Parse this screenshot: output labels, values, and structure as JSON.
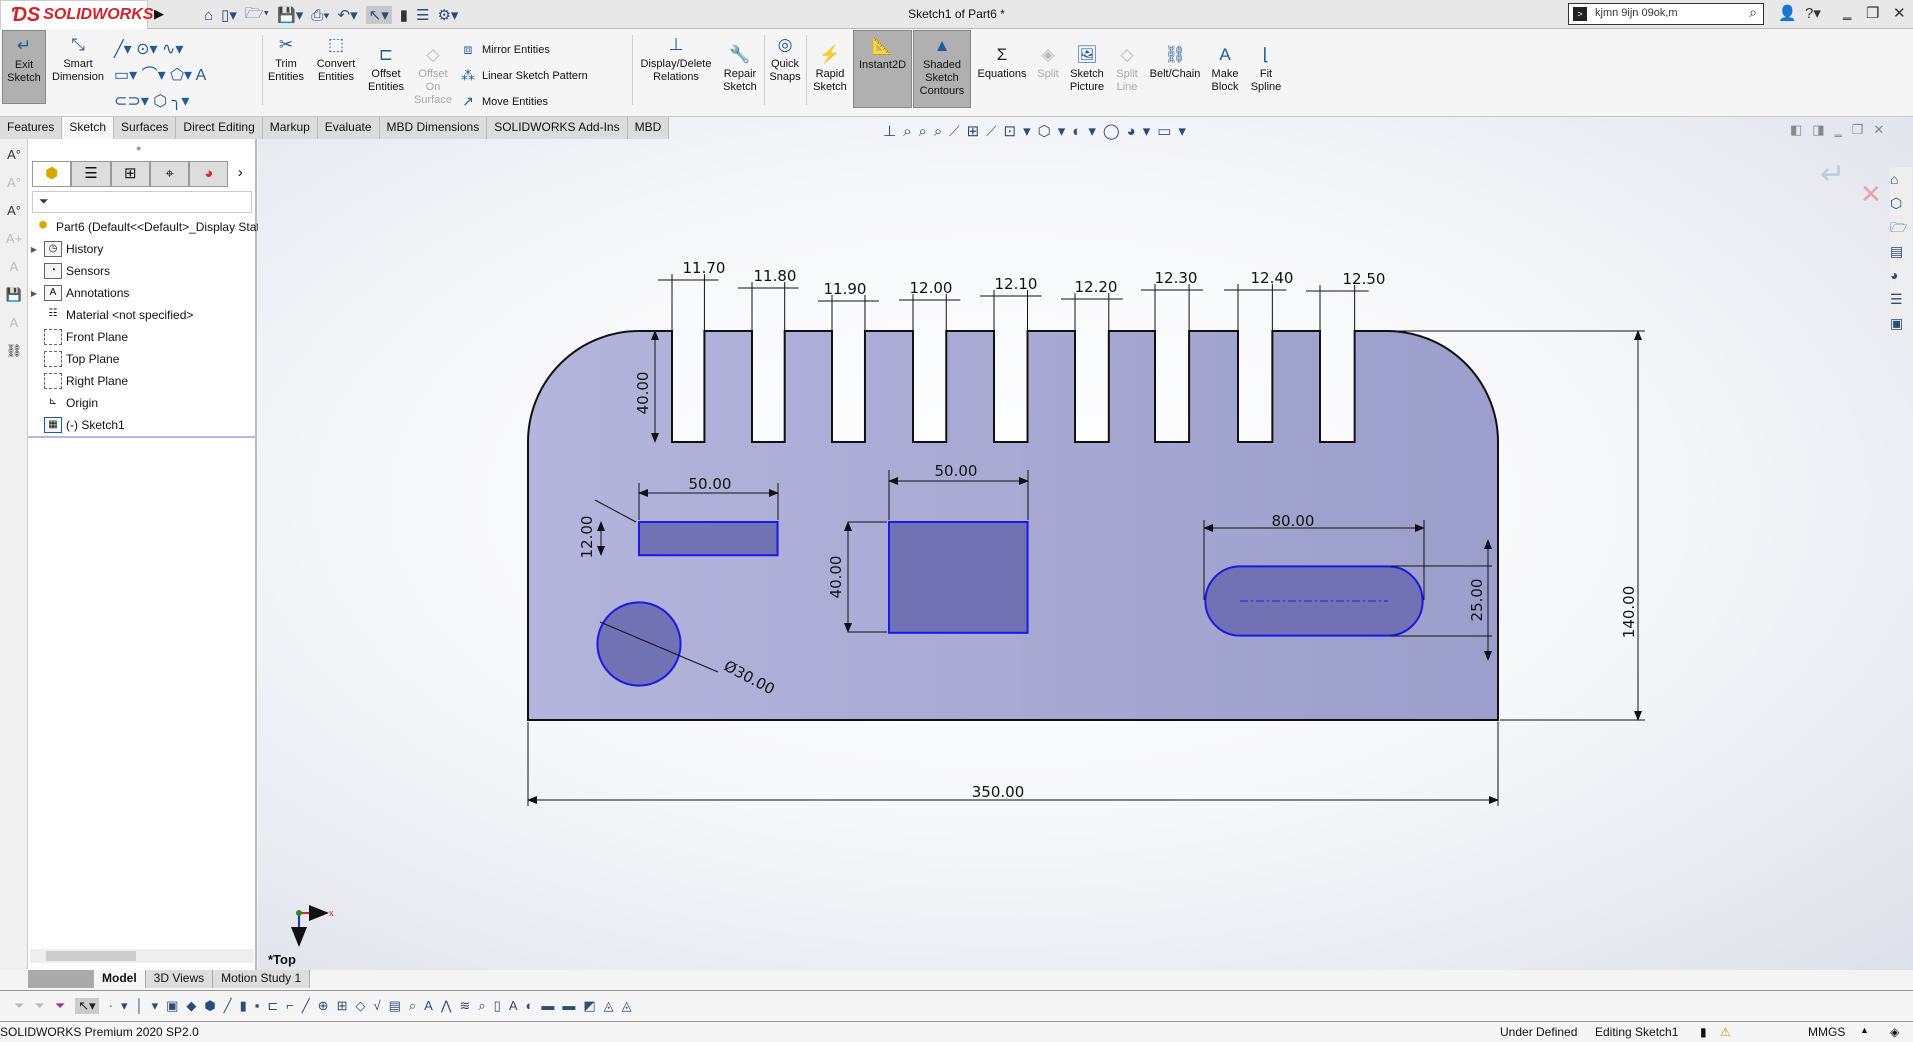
{
  "app": {
    "logo": "SOLIDWORKS",
    "title": "Sketch1 of Part6 *",
    "search_value": "kjmn 9ijn 09ok,m"
  },
  "ribbon": {
    "exit_sketch": "Exit Sketch",
    "smart_dimension": "Smart Dimension",
    "trim": "Trim Entities",
    "convert": "Convert Entities",
    "offset": "Offset Entities",
    "offset_surface": "Offset On Surface",
    "mirror": "Mirror Entities",
    "linear_pattern": "Linear Sketch Pattern",
    "move": "Move Entities",
    "display_delete": "Display/Delete Relations",
    "repair": "Repair Sketch",
    "quick_snaps": "Quick Snaps",
    "rapid": "Rapid Sketch",
    "instant2d": "Instant2D",
    "shaded": "Shaded Sketch Contours",
    "equations": "Equations",
    "split": "Split",
    "sketch_picture": "Sketch Picture",
    "split_line": "Split Line",
    "belt": "Belt/Chain",
    "make_block": "Make Block",
    "fit_spline": "Fit Spline"
  },
  "tabs": [
    "Features",
    "Sketch",
    "Surfaces",
    "Direct Editing",
    "Markup",
    "Evaluate",
    "MBD Dimensions",
    "SOLIDWORKS Add-Ins",
    "MBD"
  ],
  "active_tab": "Sketch",
  "tree": {
    "root": "Part6  (Default<<Default>_Display State",
    "items": [
      {
        "label": "History",
        "expandable": true,
        "icon": "history-folder"
      },
      {
        "label": "Sensors",
        "expandable": false,
        "icon": "sensors-folder"
      },
      {
        "label": "Annotations",
        "expandable": true,
        "icon": "annotations-folder"
      },
      {
        "label": "Material <not specified>",
        "expandable": false,
        "icon": "material"
      },
      {
        "label": "Front Plane",
        "expandable": false,
        "icon": "plane"
      },
      {
        "label": "Top Plane",
        "expandable": false,
        "icon": "plane"
      },
      {
        "label": "Right Plane",
        "expandable": false,
        "icon": "plane"
      },
      {
        "label": "Origin",
        "expandable": false,
        "icon": "origin"
      },
      {
        "label": "(-) Sketch1",
        "expandable": false,
        "icon": "sketch"
      }
    ]
  },
  "sketch": {
    "view_label": "*Top",
    "slot_widths": [
      "11.70",
      "11.80",
      "11.90",
      "12.00",
      "12.10",
      "12.20",
      "12.30",
      "12.40",
      "12.50"
    ],
    "slot_depth": "40.00",
    "rect1_width": "50.00",
    "rect1_height": "12.00",
    "rect2_width": "50.00",
    "rect2_height": "40.00",
    "slot_length": "80.00",
    "slot_height": "25.00",
    "circle_diameter": "Ø30.00",
    "overall_height": "140.00",
    "overall_width": "350.00",
    "fill_color": "#a9abd2",
    "selected_color": "#1a1ae6"
  },
  "bottom_tabs": [
    "Model",
    "3D Views",
    "Motion Study 1"
  ],
  "status": {
    "version": "SOLIDWORKS Premium 2020 SP2.0",
    "state": "Under Defined",
    "editing": "Editing Sketch1",
    "units": "MMGS"
  }
}
